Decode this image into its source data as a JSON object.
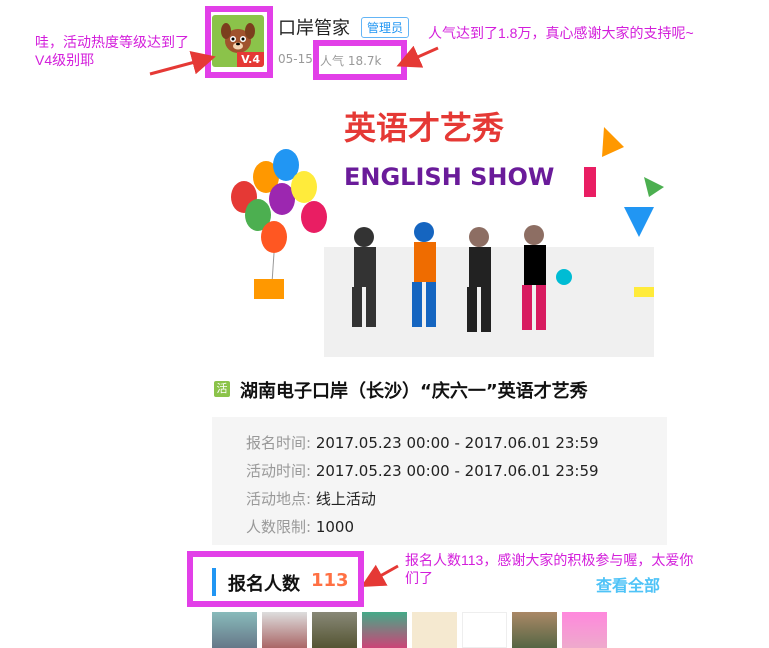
{
  "post": {
    "author": "口岸管家",
    "role_badge": "管理员",
    "avatar_level": "V.4",
    "date": "05-15",
    "popularity": "人气 18.7k"
  },
  "annotations": {
    "level_note": "哇，活动热度等级达到了V4级别耶",
    "popularity_note": "人气达到了1.8万，真心感谢大家的支持呢~",
    "signup_note": "报名人数113，感谢大家的积极参与喔，太爱你们了"
  },
  "banner": {
    "title_cn": "英语才艺秀",
    "title_en": "ENGLISH SHOW"
  },
  "event": {
    "badge": "活",
    "title": "湖南电子口岸（长沙）“庆六一”英语才艺秀",
    "info": [
      {
        "key": "报名时间:",
        "value": "2017.05.23 00:00 - 2017.06.01 23:59"
      },
      {
        "key": "活动时间:",
        "value": "2017.05.23 00:00 - 2017.06.01 23:59"
      },
      {
        "key": "活动地点:",
        "value": "线上活动"
      },
      {
        "key": "人数限制:",
        "value": "1000"
      }
    ]
  },
  "signup": {
    "label": "报名人数",
    "count": "113",
    "view_all": "查看全部"
  },
  "colors": {
    "highlight": "#e23fe8",
    "annotation_text": "#d31edb",
    "accent_blue": "#2196f3",
    "count_orange": "#ff7043",
    "badge_green": "#8bc34a"
  }
}
